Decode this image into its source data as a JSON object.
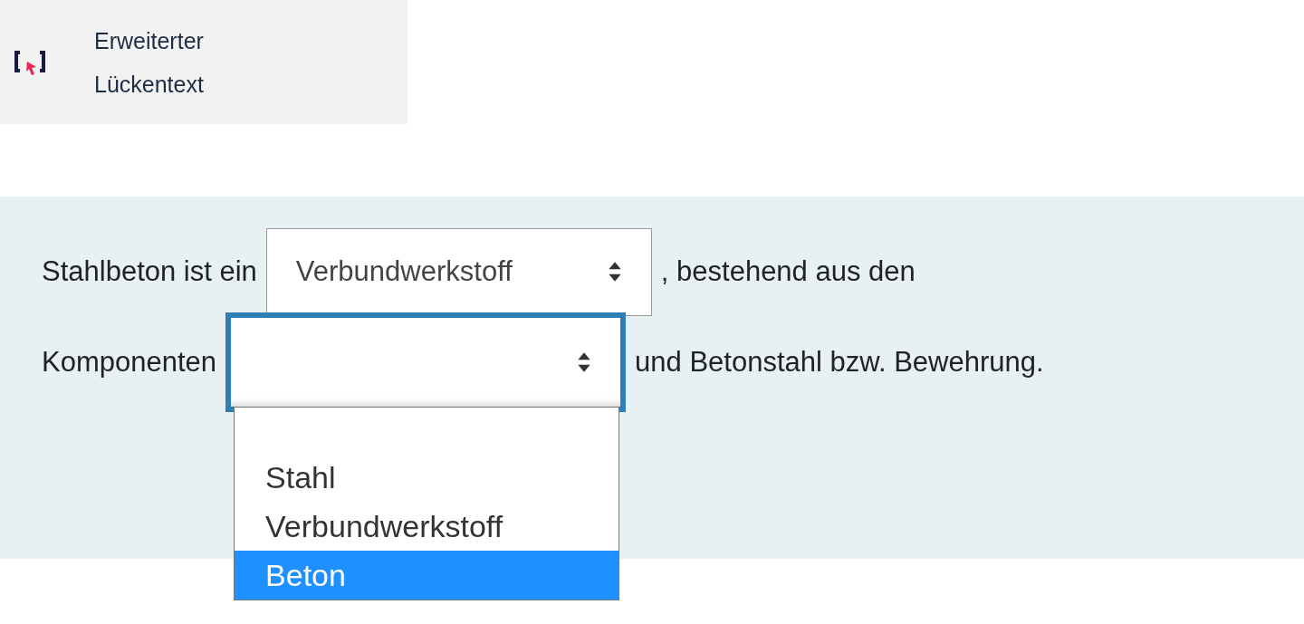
{
  "header": {
    "title": "Erweiterter Lückentext"
  },
  "question": {
    "lines": [
      [
        {
          "kind": "text",
          "text": "Stahlbeton ist ein"
        },
        {
          "kind": "select",
          "value": "Verbundwerkstoff",
          "open": false
        },
        {
          "kind": "text",
          "text": ", bestehend aus den"
        }
      ],
      [
        {
          "kind": "text",
          "text": "Komponenten"
        },
        {
          "kind": "select",
          "open": true,
          "options": [
            {
              "label": "Stahl",
              "selected": false
            },
            {
              "label": "Verbundwerkstoff",
              "selected": false
            },
            {
              "label": "Beton",
              "selected": true
            }
          ]
        },
        {
          "kind": "text",
          "text": "und Betonstahl bzw. Bewehrung."
        }
      ]
    ]
  }
}
